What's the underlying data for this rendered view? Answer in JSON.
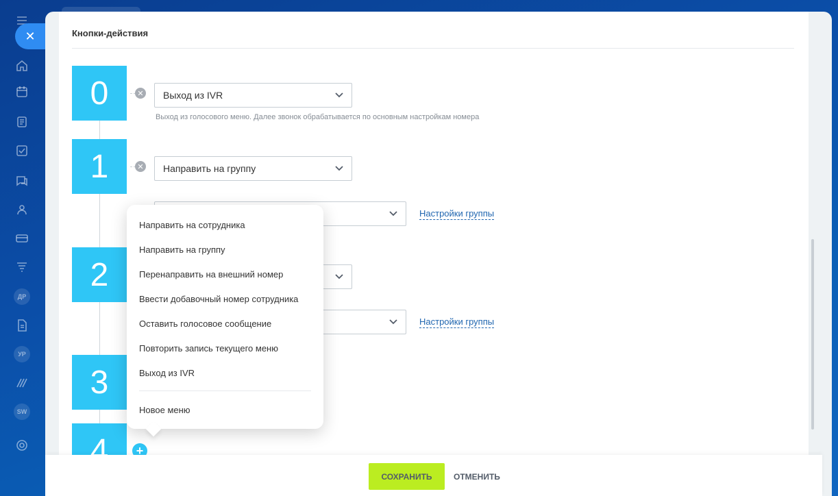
{
  "nav": {
    "close_icon": "close-icon",
    "badges": [
      "ДР",
      "УР",
      "SW"
    ],
    "icons": [
      "home-icon",
      "calendar-icon",
      "document-icon",
      "tasks-icon",
      "chat-icon",
      "contacts-icon",
      "card-icon",
      "filter-icon",
      "file-icon",
      "logo-icon",
      "settings-icon"
    ]
  },
  "section": {
    "title": "Кнопки-действия"
  },
  "buttons": [
    {
      "number": "0",
      "action": "Выход из IVR",
      "hint": "Выход из голосового меню. Далее звонок обрабатывается по основным настройкам номера"
    },
    {
      "number": "1",
      "action": "Направить на группу",
      "group_link": "Настройки группы"
    },
    {
      "number": "2",
      "group_link": "Настройки группы"
    },
    {
      "number": "3"
    },
    {
      "number": "4"
    }
  ],
  "dropdown": {
    "items": [
      "Направить на сотрудника",
      "Направить на группу",
      "Перенаправить на внешний номер",
      "Ввести добавочный номер сотрудника",
      "Оставить голосовое сообщение",
      "Повторить запись текущего меню",
      "Выход из IVR"
    ],
    "new_menu": "Новое меню"
  },
  "footer": {
    "save": "СОХРАНИТЬ",
    "cancel": "ОТМЕНИТЬ"
  },
  "colors": {
    "accent": "#2fc6f6",
    "save": "#bbed21",
    "link": "#2066b0"
  }
}
